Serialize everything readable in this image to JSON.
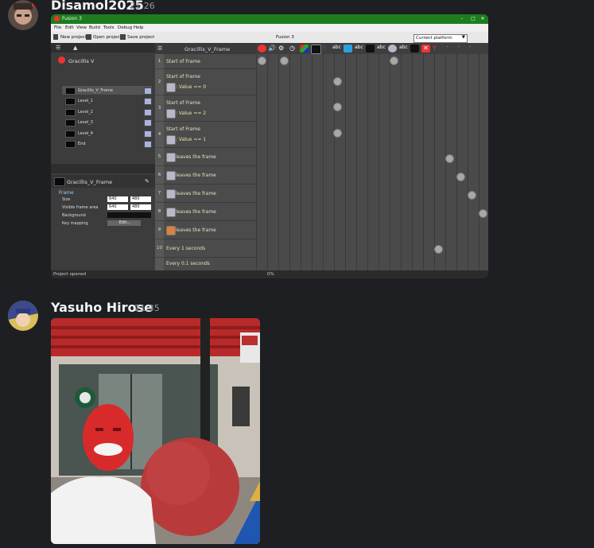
{
  "messages": [
    {
      "username": "Disamol2025",
      "time": "21:26",
      "attachment": {
        "type": "screenshot",
        "window_title": "Fusion 3",
        "menu": [
          "File",
          "Edit",
          "View",
          "Build",
          "Tools",
          "Debug",
          "Help"
        ],
        "toolbar": {
          "new_project": "New project",
          "open_project": "Open project",
          "save_project": "Save project",
          "center_title": "Fusion 3"
        },
        "platform_select": "Current platform",
        "tree": {
          "root": "Gracillis V",
          "frames": [
            "Gracillis_V_Frame",
            "Level_1",
            "Level_2",
            "Level_3",
            "Level_4",
            "End"
          ]
        },
        "properties": {
          "frame_name": "Gracillis_V_Frame",
          "section": "Frame",
          "rows": [
            {
              "label": "Size",
              "v1": "640",
              "v2": "480"
            },
            {
              "label": "Visible frame area",
              "v1": "640",
              "v2": "480"
            },
            {
              "label": "Background",
              "v1": "",
              "v2": ""
            },
            {
              "label": "Key mapping",
              "v1": "Edit...",
              "v2": ""
            }
          ]
        },
        "event_editor": {
          "frame_title": "Gracillis_V_Frame",
          "rows": [
            {
              "num": "1",
              "cond": "Start of Frame",
              "sub": ""
            },
            {
              "num": "2",
              "cond": "Start of Frame",
              "sub": ": Value == 0"
            },
            {
              "num": "3",
              "cond": "Start of Frame",
              "sub": ": Value == 2"
            },
            {
              "num": "4",
              "cond": "Start of Frame",
              "sub": ": Value == 1"
            },
            {
              "num": "5",
              "cond": "leaves the frame",
              "sub": ""
            },
            {
              "num": "6",
              "cond": "leaves the frame",
              "sub": ""
            },
            {
              "num": "7",
              "cond": "leaves the frame",
              "sub": ""
            },
            {
              "num": "8",
              "cond": "leaves the frame",
              "sub": ""
            },
            {
              "num": "9",
              "cond": "leaves the frame",
              "sub": ""
            },
            {
              "num": "10",
              "cond": "Every 1 seconds",
              "sub": ""
            },
            {
              "num": "",
              "cond": "Every 0.1 seconds",
              "sub": ""
            }
          ],
          "header_labels": [
            "abc",
            "abc",
            "abc",
            "abc",
            "abc"
          ]
        },
        "status_left": "Project opened",
        "status_mid": "0%"
      }
    },
    {
      "username": "Yasuho Hirose",
      "time": "21:35",
      "attachment": {
        "type": "photo"
      }
    }
  ],
  "colors": {
    "background": "#1e1f22",
    "username": "#f2f3f5",
    "timestamp": "#949ba4",
    "fusion_title": "#1d7d1d"
  }
}
